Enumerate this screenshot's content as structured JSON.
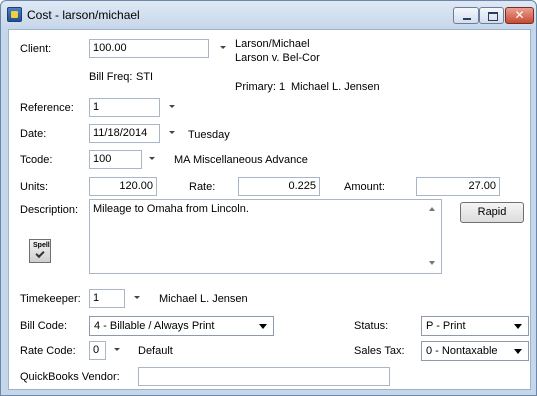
{
  "window": {
    "title": "Cost - larson/michael",
    "close_glyph": "✕"
  },
  "client": {
    "label": "Client:",
    "value": "100.00",
    "name": "Larson/Michael",
    "matter": "Larson v. Bel-Cor",
    "bill_freq_label": "Bill Freq:",
    "bill_freq_value": "STI",
    "primary_label": "Primary:",
    "primary_num": "1",
    "primary_name": "Michael L. Jensen"
  },
  "reference": {
    "label": "Reference:",
    "value": "1"
  },
  "date": {
    "label": "Date:",
    "value": "11/18/2014",
    "weekday": "Tuesday"
  },
  "tcode": {
    "label": "Tcode:",
    "value": "100",
    "description": "MA Miscellaneous Advance"
  },
  "units": {
    "label": "Units:",
    "value": "120.00"
  },
  "rate": {
    "label": "Rate:",
    "value": "0.225"
  },
  "amount": {
    "label": "Amount:",
    "value": "27.00"
  },
  "description": {
    "label": "Description:",
    "value": "Mileage to Omaha from Lincoln."
  },
  "rapid_button": "Rapid",
  "spell_button": "Spell",
  "timekeeper": {
    "label": "Timekeeper:",
    "value": "1",
    "name": "Michael L. Jensen"
  },
  "bill_code": {
    "label": "Bill Code:",
    "value": "4 - Billable / Always Print"
  },
  "status": {
    "label": "Status:",
    "value": "P - Print"
  },
  "rate_code": {
    "label": "Rate Code:",
    "value": "0",
    "name": "Default"
  },
  "sales_tax": {
    "label": "Sales Tax:",
    "value": "0 - Nontaxable"
  },
  "quickbooks": {
    "label": "QuickBooks Vendor:",
    "value": ""
  }
}
